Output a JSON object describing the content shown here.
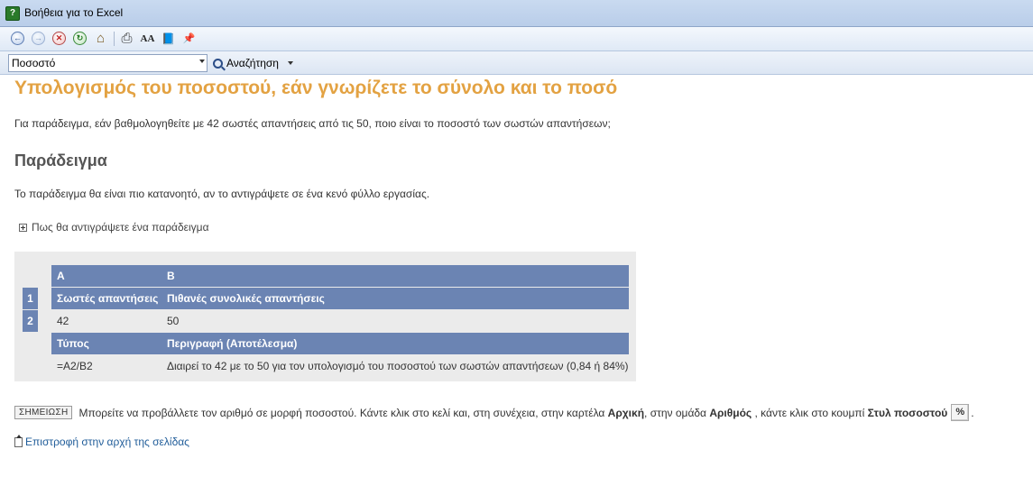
{
  "window": {
    "title": "Βοήθεια για το Excel"
  },
  "toolbar": {
    "buttons": [
      {
        "icon": "back-icon",
        "glyph": "←"
      },
      {
        "icon": "forward-icon",
        "glyph": "→"
      },
      {
        "icon": "stop-icon",
        "glyph": "✕"
      },
      {
        "icon": "refresh-icon",
        "glyph": "↻"
      },
      {
        "icon": "home-icon",
        "glyph": "⌂"
      },
      {
        "icon": "print-icon",
        "glyph": "⎙"
      },
      {
        "icon": "font-size-icon",
        "glyph": "AA"
      },
      {
        "icon": "table-of-contents-icon",
        "glyph": "📘"
      },
      {
        "icon": "keep-on-top-icon",
        "glyph": "📌"
      }
    ]
  },
  "search": {
    "value": "Ποσοστό",
    "button_label": "Αναζήτηση"
  },
  "article": {
    "title": "Υπολογισμός του ποσοστού, εάν γνωρίζετε το σύνολο και το ποσό",
    "intro": "Για παράδειγμα, εάν βαθμολογηθείτε με 42 σωστές απαντήσεις από τις 50, ποιο είναι το ποσοστό των σωστών απαντήσεων;",
    "example_heading": "Παράδειγμα",
    "example_text": "Το παράδειγμα θα είναι πιο κατανοητό, αν το αντιγράψετε σε ένα κενό φύλλο εργασίας.",
    "expander_label": "Πως θα αντιγράψετε ένα παράδειγμα",
    "table": {
      "col_letters": [
        "A",
        "B"
      ],
      "row_numbers": [
        "1",
        "2"
      ],
      "headers": [
        "Σωστές απαντήσεις",
        "Πιθανές συνολικές απαντήσεις"
      ],
      "values": [
        "42",
        "50"
      ],
      "formula_headers": [
        "Τύπος",
        "Περιγραφή (Αποτέλεσμα)"
      ],
      "formula": "=A2/B2",
      "description": "Διαιρεί το 42 με το 50 για τον υπολογισμό του ποσοστού των σωστών απαντήσεων (0,84 ή 84%)"
    },
    "note": {
      "badge": "ΣΗΜΕΙΩΣΗ",
      "text1": "Μπορείτε να προβάλλετε τον αριθμό σε μορφή ποσοστού. Κάντε κλικ στο κελί και, στη συνέχεια, στην καρτέλα ",
      "bold1": "Αρχική",
      "text2": ", στην ομάδα ",
      "bold2": "Αριθμός",
      "text3": " , κάντε κλικ στο κουμπί ",
      "bold3": "Στυλ ποσοστού",
      "button_glyph": "%",
      "text4": "."
    },
    "back_to_top": "Επιστροφή στην αρχή της σελίδας"
  }
}
